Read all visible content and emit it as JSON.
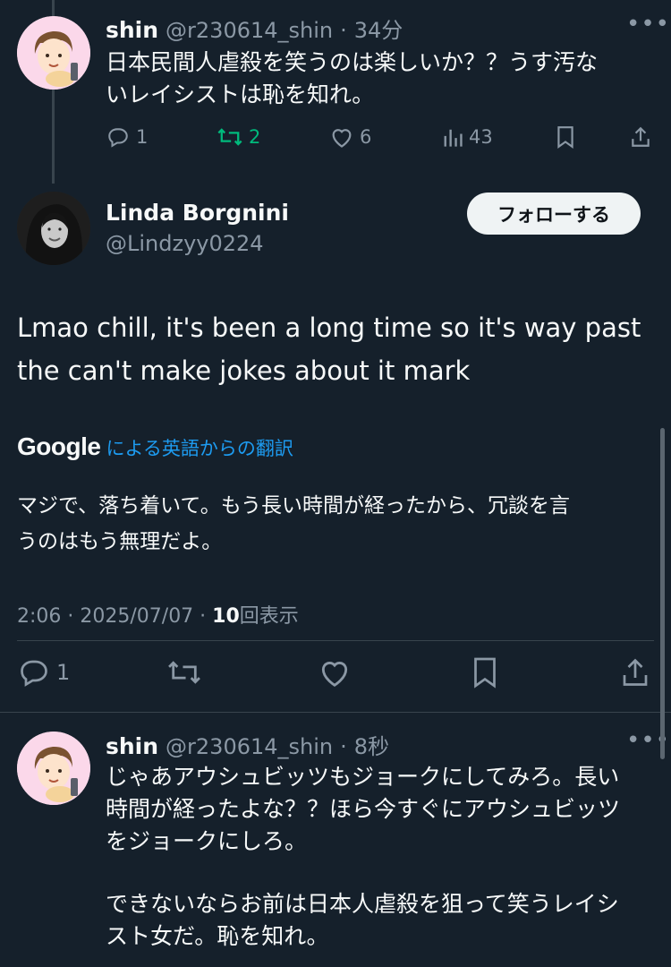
{
  "reply1": {
    "name": "shin",
    "handle": "@r230614_shin",
    "sep": "·",
    "time": "34分",
    "text_line1": "日本民間人虐殺を笑うのは楽しいか？？うす汚な",
    "text_line2": "いレイシストは恥を知れ。",
    "stats": {
      "replies": "1",
      "reposts": "2",
      "likes": "6",
      "views": "43"
    }
  },
  "main": {
    "name": "Linda Borgnini",
    "handle": "@Lindzyy0224",
    "follow_label": "フォローする",
    "text_line1": "Lmao chill, it's been a long time so it's way past",
    "text_line2": "the can't make jokes about it mark",
    "translate_brand": "Google",
    "translate_label": "による英語からの翻訳",
    "translation_line1": "マジで、落ち着いて。もう長い時間が経ったから、冗談を言",
    "translation_line2": "うのはもう無理だよ。",
    "meta_time": "2:06 · 2025/07/07 · ",
    "meta_views_count": "10",
    "meta_views_label": "回表示",
    "reply_count": "1"
  },
  "reply2": {
    "name": "shin",
    "handle": "@r230614_shin",
    "sep": "·",
    "time": "8秒",
    "text_line1": "じゃあアウシュビッツもジョークにしてみろ。長い",
    "text_line2": "時間が経ったよな？？ほら今すぐにアウシュビッツ",
    "text_line3": "をジョークにしろ。",
    "text_line4": "できないならお前は日本人虐殺を狙って笑うレイシ",
    "text_line5": "スト女だ。恥を知れ。"
  },
  "icons": {
    "more": "more-icon",
    "reply": "reply-icon",
    "repost": "repost-icon",
    "like": "like-icon",
    "views": "views-icon",
    "bookmark": "bookmark-icon",
    "share": "share-icon"
  },
  "colors": {
    "background": "#15202b",
    "repost_active": "#00ba7c",
    "link": "#1d9bf0",
    "muted": "#8b98a5"
  }
}
